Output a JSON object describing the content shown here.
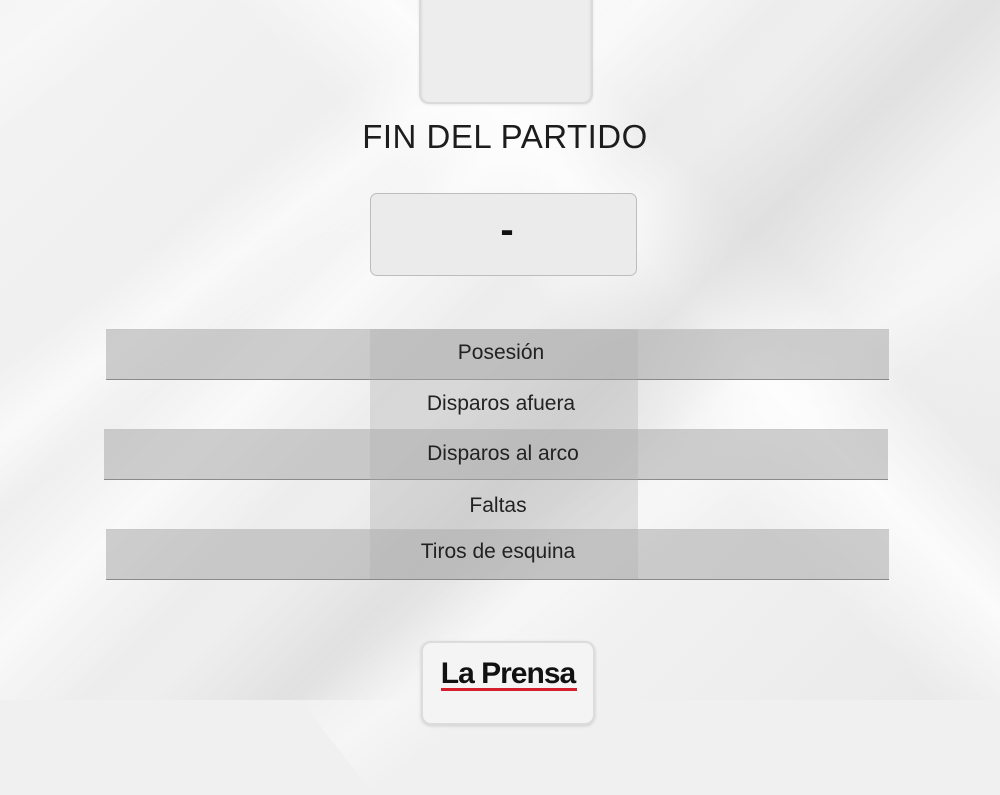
{
  "match": {
    "status": "FIN DEL PARTIDO",
    "score": "-"
  },
  "stats": {
    "rows": [
      {
        "label": "Posesión"
      },
      {
        "label": "Disparos afuera"
      },
      {
        "label": "Disparos al arco"
      },
      {
        "label": "Faltas"
      },
      {
        "label": "Tiros de esquina"
      }
    ]
  },
  "brand": {
    "name": "La Prensa",
    "accent": "#d21f2b"
  }
}
